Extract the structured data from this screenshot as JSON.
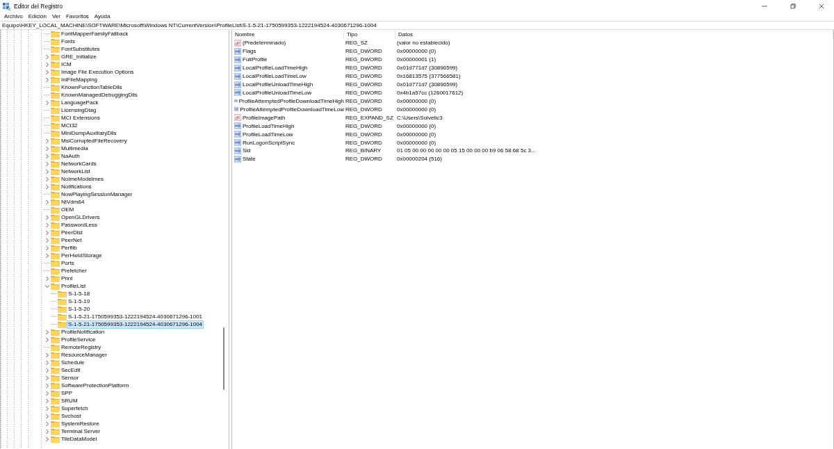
{
  "window": {
    "title": "Editor del Registro"
  },
  "menu": [
    "Archivo",
    "Edición",
    "Ver",
    "Favoritos",
    "Ayuda"
  ],
  "address_bar": {
    "value": "Equipo\\HKEY_LOCAL_MACHINE\\SOFTWARE\\Microsoft\\Windows NT\\CurrentVersion\\ProfileList\\S-1-5-21-1750599353-1222194524-4030671296-1004"
  },
  "tree": {
    "items": [
      {
        "label": "FontMapperFamilyFallback",
        "kind": "leaf",
        "selected": false
      },
      {
        "label": "Fonts",
        "kind": "leaf",
        "selected": false
      },
      {
        "label": "FontSubstitutes",
        "kind": "leaf",
        "selected": false
      },
      {
        "label": "GRE_Initialize",
        "kind": "branch",
        "expanded": false,
        "selected": false
      },
      {
        "label": "ICM",
        "kind": "branch",
        "expanded": false,
        "selected": false
      },
      {
        "label": "Image File Execution Options",
        "kind": "branch",
        "expanded": false,
        "selected": false
      },
      {
        "label": "IniFileMapping",
        "kind": "branch",
        "expanded": false,
        "selected": false
      },
      {
        "label": "KnownFunctionTableDlls",
        "kind": "leaf",
        "selected": false
      },
      {
        "label": "KnownManagedDebuggingDlls",
        "kind": "leaf",
        "selected": false
      },
      {
        "label": "LanguagePack",
        "kind": "branch",
        "expanded": false,
        "selected": false
      },
      {
        "label": "LicensingDiag",
        "kind": "leaf",
        "selected": false
      },
      {
        "label": "MCI Extensions",
        "kind": "leaf",
        "selected": false
      },
      {
        "label": "MCI32",
        "kind": "leaf",
        "selected": false
      },
      {
        "label": "MiniDumpAuxiliaryDlls",
        "kind": "leaf",
        "selected": false
      },
      {
        "label": "MsiCorruptedFileRecovery",
        "kind": "branch",
        "expanded": false,
        "selected": false
      },
      {
        "label": "Multimedia",
        "kind": "branch",
        "expanded": false,
        "selected": false
      },
      {
        "label": "NaAuth",
        "kind": "branch",
        "expanded": false,
        "selected": false
      },
      {
        "label": "NetworkCards",
        "kind": "branch",
        "expanded": false,
        "selected": false
      },
      {
        "label": "NetworkList",
        "kind": "branch",
        "expanded": false,
        "selected": false
      },
      {
        "label": "NoImeModeImes",
        "kind": "branch",
        "expanded": false,
        "selected": false
      },
      {
        "label": "Notifications",
        "kind": "branch",
        "expanded": false,
        "selected": false
      },
      {
        "label": "NowPlayingSessionManager",
        "kind": "leaf",
        "selected": false
      },
      {
        "label": "NtVdm64",
        "kind": "branch",
        "expanded": false,
        "selected": false
      },
      {
        "label": "OEM",
        "kind": "leaf",
        "selected": false
      },
      {
        "label": "OpenGLDrivers",
        "kind": "branch",
        "expanded": false,
        "selected": false
      },
      {
        "label": "PasswordLess",
        "kind": "branch",
        "expanded": false,
        "selected": false
      },
      {
        "label": "PeerDist",
        "kind": "branch",
        "expanded": false,
        "selected": false
      },
      {
        "label": "PeerNet",
        "kind": "branch",
        "expanded": false,
        "selected": false
      },
      {
        "label": "Perflib",
        "kind": "branch",
        "expanded": false,
        "selected": false
      },
      {
        "label": "PerHwIdStorage",
        "kind": "branch",
        "expanded": false,
        "selected": false
      },
      {
        "label": "Ports",
        "kind": "leaf",
        "selected": false
      },
      {
        "label": "Prefetcher",
        "kind": "leaf",
        "selected": false
      },
      {
        "label": "Print",
        "kind": "branch",
        "expanded": false,
        "selected": false
      },
      {
        "label": "ProfileList",
        "kind": "branch",
        "expanded": true,
        "selected": false,
        "children": [
          {
            "label": "S-1-5-18",
            "kind": "leaf",
            "selected": false
          },
          {
            "label": "S-1-5-19",
            "kind": "leaf",
            "selected": false
          },
          {
            "label": "S-1-5-20",
            "kind": "leaf",
            "selected": false
          },
          {
            "label": "S-1-5-21-1750599353-1222194524-4030671296-1001",
            "kind": "leaf",
            "selected": false
          },
          {
            "label": "S-1-5-21-1750599353-1222194524-4030671296-1004",
            "kind": "leaf",
            "selected": true
          }
        ]
      },
      {
        "label": "ProfileNotification",
        "kind": "branch",
        "expanded": false,
        "selected": false
      },
      {
        "label": "ProfileService",
        "kind": "branch",
        "expanded": false,
        "selected": false
      },
      {
        "label": "RemoteRegistry",
        "kind": "leaf",
        "selected": false
      },
      {
        "label": "ResourceManager",
        "kind": "branch",
        "expanded": false,
        "selected": false
      },
      {
        "label": "Schedule",
        "kind": "branch",
        "expanded": false,
        "selected": false
      },
      {
        "label": "SecEdit",
        "kind": "branch",
        "expanded": false,
        "selected": false
      },
      {
        "label": "Sensor",
        "kind": "branch",
        "expanded": false,
        "selected": false
      },
      {
        "label": "SoftwareProtectionPlatform",
        "kind": "branch",
        "expanded": false,
        "selected": false
      },
      {
        "label": "SPP",
        "kind": "branch",
        "expanded": false,
        "selected": false
      },
      {
        "label": "SRUM",
        "kind": "branch",
        "expanded": false,
        "selected": false
      },
      {
        "label": "Superfetch",
        "kind": "branch",
        "expanded": false,
        "selected": false
      },
      {
        "label": "Svchost",
        "kind": "branch",
        "expanded": false,
        "selected": false
      },
      {
        "label": "SystemRestore",
        "kind": "branch",
        "expanded": false,
        "selected": false
      },
      {
        "label": "Terminal Server",
        "kind": "branch",
        "expanded": false,
        "selected": false
      },
      {
        "label": "TileDataModel",
        "kind": "branch",
        "expanded": false,
        "selected": false
      }
    ]
  },
  "values": {
    "columns": [
      "Nombre",
      "Tipo",
      "Datos"
    ],
    "rows": [
      {
        "kind": "string",
        "name": "(Predeterminado)",
        "type": "REG_SZ",
        "data": "(valor no establecido)"
      },
      {
        "kind": "binary",
        "name": "Flags",
        "type": "REG_DWORD",
        "data": "0x00000000 (0)"
      },
      {
        "kind": "binary",
        "name": "FullProfile",
        "type": "REG_DWORD",
        "data": "0x00000001 (1)"
      },
      {
        "kind": "binary",
        "name": "LocalProfileLoadTimeHigh",
        "type": "REG_DWORD",
        "data": "0x01d771d7 (30896599)"
      },
      {
        "kind": "binary",
        "name": "LocalProfileLoadTimeLow",
        "type": "REG_DWORD",
        "data": "0x16813575 (377566581)"
      },
      {
        "kind": "binary",
        "name": "LocalProfileUnloadTimeHigh",
        "type": "REG_DWORD",
        "data": "0x01d771d7 (30896599)"
      },
      {
        "kind": "binary",
        "name": "LocalProfileUnloadTimeLow",
        "type": "REG_DWORD",
        "data": "0x4b1a57cc (1260017612)"
      },
      {
        "kind": "binary",
        "name": "ProfileAttemptedProfileDownloadTimeHigh",
        "type": "REG_DWORD",
        "data": "0x00000000 (0)"
      },
      {
        "kind": "binary",
        "name": "ProfileAttemptedProfileDownloadTimeLow",
        "type": "REG_DWORD",
        "data": "0x00000000 (0)"
      },
      {
        "kind": "string",
        "name": "ProfileImagePath",
        "type": "REG_EXPAND_SZ",
        "data": "C:\\Users\\Solvetic3"
      },
      {
        "kind": "binary",
        "name": "ProfileLoadTimeHigh",
        "type": "REG_DWORD",
        "data": "0x00000000 (0)"
      },
      {
        "kind": "binary",
        "name": "ProfileLoadTimeLow",
        "type": "REG_DWORD",
        "data": "0x00000000 (0)"
      },
      {
        "kind": "binary",
        "name": "RunLogonScriptSync",
        "type": "REG_DWORD",
        "data": "0x00000000 (0)"
      },
      {
        "kind": "binary",
        "name": "Sid",
        "type": "REG_BINARY",
        "data": "01 05 00 00 00 00 00 05 15 00 00 00 b9 06 58 68 5c 3..."
      },
      {
        "kind": "binary",
        "name": "State",
        "type": "REG_DWORD",
        "data": "0x00000204 (516)"
      }
    ]
  }
}
